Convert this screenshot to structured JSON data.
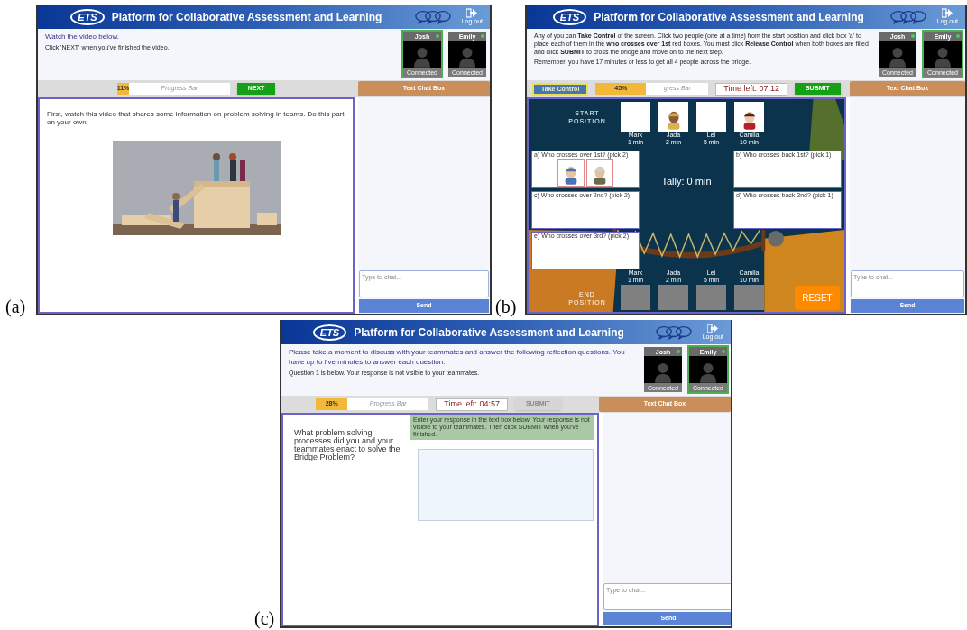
{
  "panels": [
    {
      "label": "(a)",
      "header": {
        "logo": "ETS",
        "title": "Platform for Collaborative Assessment and Learning",
        "logout": "Log out"
      },
      "instructions": [
        {
          "kind": "heading",
          "text": "Watch the video below."
        },
        {
          "kind": "note",
          "text": "Click 'NEXT' when you've finished the video."
        }
      ],
      "webcams": [
        {
          "name": "Josh",
          "status": "Connected",
          "selected": true
        },
        {
          "name": "Emily",
          "status": "Connected",
          "selected": false
        }
      ],
      "toolbar": [
        {
          "kind": "progress",
          "level": 0.11,
          "percent": "11%",
          "label": "Progress Bar"
        },
        {
          "kind": "button",
          "text": "NEXT",
          "disabled": false
        }
      ],
      "content": {
        "kind": "video",
        "text": "First, watch this video that shares some information on problem solving in teams. Do this part on your own."
      },
      "chat": {
        "title": "Text Chat Box",
        "placeholder": "Type to chat...",
        "send": "Send"
      }
    },
    {
      "label": "(b)",
      "header": {
        "logo": "ETS",
        "title": "Platform for Collaborative Assessment and Learning",
        "logout": "Log out"
      },
      "instructions": [
        {
          "kind": "body",
          "text": "Any of you can **Take Control** of the screen. Click two people (one at a time) from the start position and click box 'a' to place each of them in the **who crosses over 1st** red boxes. You must click **Release Control** when both boxes are filled and click **SUBMIT** to cross the bridge and move on to the next step."
        },
        {
          "kind": "body",
          "text": "Remember, you have 17 minutes or less to get all 4 people across the bridge."
        }
      ],
      "webcams": [
        {
          "name": "Josh",
          "status": "Connected",
          "selected": false
        },
        {
          "name": "Emily",
          "status": "Connected",
          "selected": true
        }
      ],
      "toolbar": [
        {
          "kind": "control_button",
          "text": "Take Control"
        },
        {
          "kind": "progress",
          "level": 0.45,
          "percent": "45%",
          "label": "gress Bar"
        },
        {
          "kind": "timer",
          "text": "Time left: 07:12"
        },
        {
          "kind": "button",
          "text": "SUBMIT",
          "disabled": false
        }
      ],
      "content": {
        "kind": "game",
        "start_label": "START POSITION",
        "people": [
          {
            "name": "Mark",
            "time": "1 min",
            "occupied": false
          },
          {
            "name": "Jada",
            "time": "2 min",
            "occupied": true
          },
          {
            "name": "Lei",
            "time": "5 min",
            "occupied": false
          },
          {
            "name": "Camila",
            "time": "10 min",
            "occupied": true
          }
        ],
        "left_boxes": [
          {
            "label": "a) Who crosses over 1st? (pick 2)",
            "picks": [
              {
                "occupied": true
              },
              {
                "occupied": true
              }
            ]
          },
          {
            "label": "c) Who crosses over 2nd? (pick 2)"
          },
          {
            "label": "e) Who crosses over 3rd? (pick 2)"
          }
        ],
        "right_boxes": [
          {
            "label": "b) Who crosses back 1st? (pick 1)"
          },
          {
            "label": "d) Who crosses back 2nd? (pick 1)"
          }
        ],
        "tally": "Tally: 0 min",
        "end_label": "END POSITION",
        "end_slots": [
          {
            "name": "Mark",
            "time": "1 min"
          },
          {
            "name": "Jada",
            "time": "2 min"
          },
          {
            "name": "Lei",
            "time": "5 min"
          },
          {
            "name": "Camila",
            "time": "10 min"
          }
        ],
        "reset": "RESET"
      },
      "chat": {
        "title": "Text Chat Box",
        "placeholder": "Type to chat...",
        "send": "Send"
      }
    },
    {
      "label": "(c)",
      "header": {
        "logo": "ETS",
        "title": "Platform for Collaborative Assessment and Learning",
        "logout": "Log out"
      },
      "instructions": [
        {
          "kind": "heading",
          "text": "Please take a moment to discuss with your teammates and answer the following reflection questions. You have up to five minutes to answer each question."
        },
        {
          "kind": "note",
          "text": "Question 1 is below. Your response is not visible to your teammates."
        }
      ],
      "webcams": [
        {
          "name": "Josh",
          "status": "Connected",
          "selected": false
        },
        {
          "name": "Emily",
          "status": "Connected",
          "selected": true
        }
      ],
      "toolbar": [
        {
          "kind": "progress",
          "level": 0.28,
          "percent": "28%",
          "label": "Progress Bar"
        },
        {
          "kind": "timer",
          "text": "Time left: 04:57"
        },
        {
          "kind": "button",
          "text": "SUBMIT",
          "disabled": true
        }
      ],
      "content": {
        "kind": "question",
        "question": "What problem solving processes did you and your teammates enact to solve the Bridge Problem?",
        "hint": "Enter your response in the text box below. Your response is not visible to your teammates. Then click SUBMIT when you've finished."
      },
      "chat": {
        "title": "Text Chat Box",
        "placeholder": "Type to chat...",
        "send": "Send"
      }
    }
  ]
}
